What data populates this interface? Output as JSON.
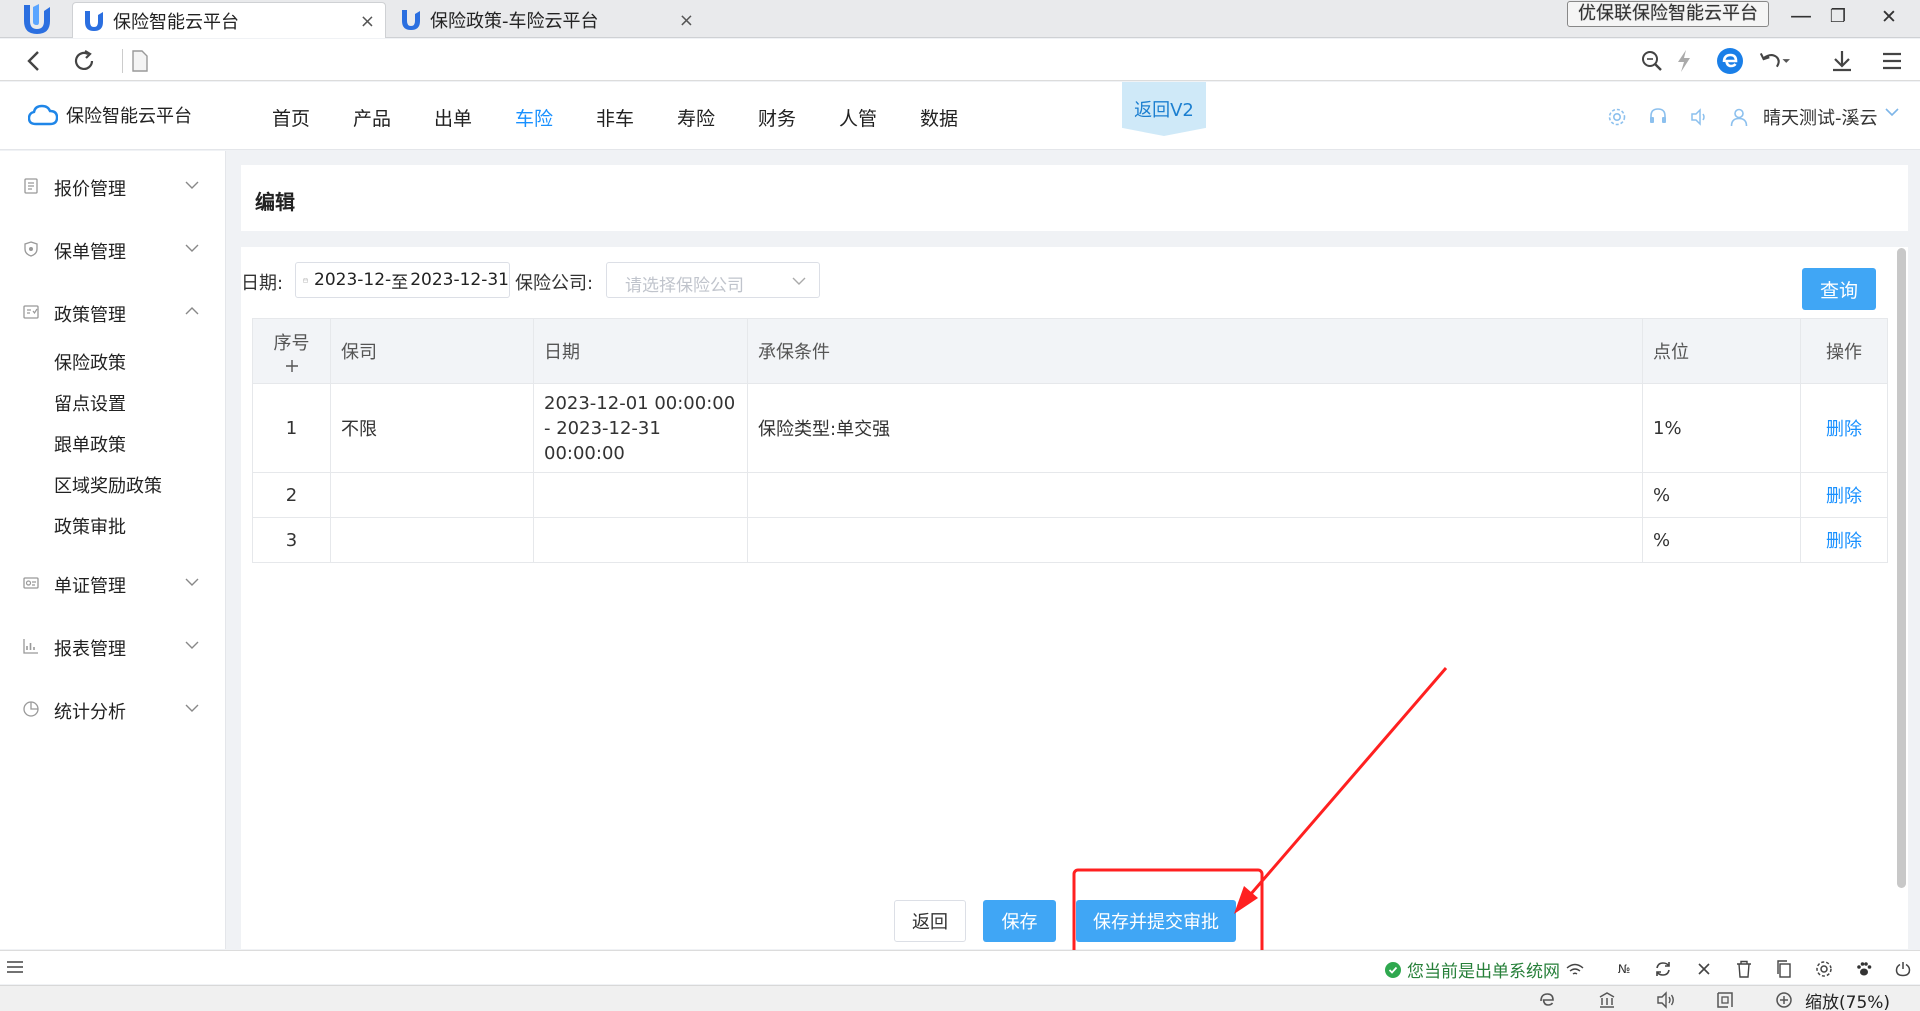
{
  "browser": {
    "tabs": [
      {
        "title": "保险智能云平台",
        "active": true
      },
      {
        "title": "保险政策-车险云平台",
        "active": false
      }
    ],
    "brand_tag": "优保联保险智能云平台",
    "tab_close_glyph": "×",
    "window_controls": {
      "minimize": "—",
      "maximize": "❐",
      "close": "✕"
    }
  },
  "app": {
    "name": "保险智能云平台",
    "nav": [
      "首页",
      "产品",
      "出单",
      "车险",
      "非车",
      "寿险",
      "财务",
      "人管",
      "数据"
    ],
    "nav_active": "车险",
    "back_v2": "返回V2",
    "user": "晴天测试-溪云"
  },
  "sidebar": {
    "menus": [
      {
        "label": "报价管理",
        "icon": "document-icon",
        "expanded": false
      },
      {
        "label": "保单管理",
        "icon": "shield-icon",
        "expanded": false
      },
      {
        "label": "政策管理",
        "icon": "policy-icon",
        "expanded": true
      },
      {
        "label": "单证管理",
        "icon": "certificate-icon",
        "expanded": false
      },
      {
        "label": "报表管理",
        "icon": "report-chart-icon",
        "expanded": false
      },
      {
        "label": "统计分析",
        "icon": "pie-chart-icon",
        "expanded": false
      }
    ],
    "policy_submenu": [
      "保险政策",
      "留点设置",
      "跟单政策",
      "区域奖励政策",
      "政策审批"
    ]
  },
  "page": {
    "title": "编辑",
    "filter": {
      "date_label": "日期:",
      "date_start": "2023-12-",
      "date_sep": "至",
      "date_end": "2023-12-31",
      "company_label": "保险公司:",
      "company_placeholder": "请选择保险公司",
      "query_button": "查询"
    },
    "table": {
      "headers": {
        "index": "序号",
        "company": "保司",
        "date": "日期",
        "condition": "承保条件",
        "points": "点位",
        "action": "操作"
      },
      "rows": [
        {
          "index": "1",
          "company": "不限",
          "date": "2023-12-01 00:00:00 - 2023-12-31 00:00:00",
          "condition": "保险类型:单交强",
          "points": "1%",
          "action": "删除"
        },
        {
          "index": "2",
          "company": "",
          "date": "",
          "condition": "",
          "points": "%",
          "action": "删除"
        },
        {
          "index": "3",
          "company": "",
          "date": "",
          "condition": "",
          "points": "%",
          "action": "删除"
        }
      ]
    },
    "buttons": {
      "back": "返回",
      "save": "保存",
      "save_submit": "保存并提交审批"
    }
  },
  "statusbar": {
    "status_text": "您当前是出单系统网",
    "number_sign": "№",
    "zoom": "缩放(75%)"
  },
  "colors": {
    "primary": "#40a6f5",
    "link": "#1890ff",
    "annotation": "#ff2020",
    "status_green": "#2fa84f"
  }
}
